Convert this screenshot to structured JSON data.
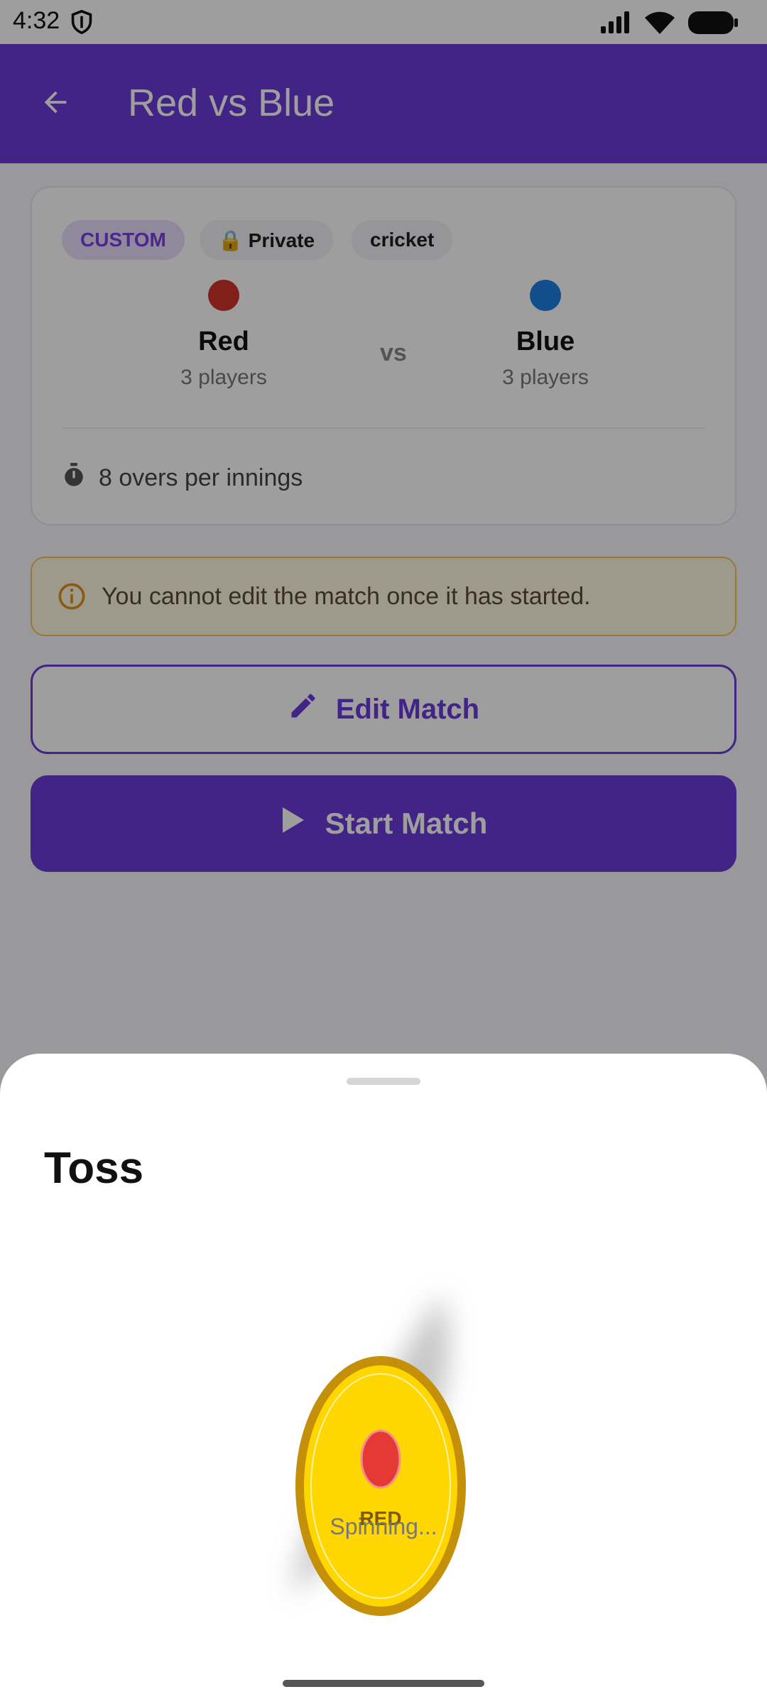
{
  "status_bar": {
    "time": "4:32"
  },
  "app_bar": {
    "title": "Red vs Blue"
  },
  "match_card": {
    "chips": {
      "custom": "CUSTOM",
      "private": "🔒 Private",
      "sport": "cricket"
    },
    "team_red": {
      "name": "Red",
      "players": "3 players",
      "color": "#d0342c"
    },
    "vs_label": "vs",
    "team_blue": {
      "name": "Blue",
      "players": "3 players",
      "color": "#1e7ee0"
    },
    "overs_text": "8 overs per innings"
  },
  "warning": {
    "text": "You cannot edit the match once it has started."
  },
  "buttons": {
    "edit_label": "Edit Match",
    "start_label": "Start Match"
  },
  "toss_sheet": {
    "title": "Toss",
    "coin_label": "RED",
    "status": "Spinning..."
  },
  "colors": {
    "primary": "#6b3bd9",
    "coin_gold": "#ffd600",
    "coin_rim": "#c4900a",
    "warning_border": "#f0c45a"
  }
}
